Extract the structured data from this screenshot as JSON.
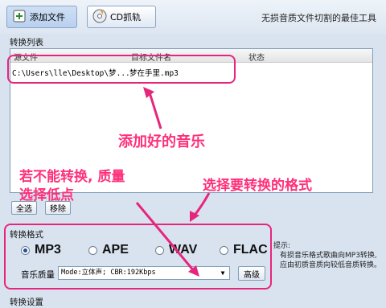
{
  "toolbar": {
    "add_file_label": "添加文件",
    "cd_label": "CD抓轨",
    "tagline": "无损音质文件切割的最佳工具"
  },
  "file_list": {
    "section_label": "转换列表",
    "columns": [
      "源文件",
      "目标文件名",
      "状态"
    ],
    "rows": [
      {
        "source": "C:\\Users\\lle\\Desktop\\梦...",
        "target": "梦在手里.mp3",
        "status": ""
      }
    ],
    "select_all_label": "全选",
    "remove_label": "移除"
  },
  "format": {
    "section_label": "转换格式",
    "options": [
      "MP3",
      "APE",
      "WAV",
      "FLAC"
    ],
    "selected": "MP3",
    "quality_label": "音乐质量",
    "quality_value": "Mode:立体声; CBR:192Kbps",
    "advanced_label": "高级"
  },
  "hint": {
    "title": "提示:",
    "text": "有损音乐格式歌曲向MP3转换, 应由初质音质向较低音质转换。"
  },
  "settings": {
    "section_label": "转换设置"
  },
  "annotations": {
    "added_music": "添加好的音乐",
    "choose_format": "选择要转换的格式",
    "low_quality_line1": "若不能转换, 质量",
    "low_quality_line2": "选择低点"
  },
  "colors": {
    "annotation": "#ff2f7a",
    "window_bg": "#d9e3ef"
  }
}
